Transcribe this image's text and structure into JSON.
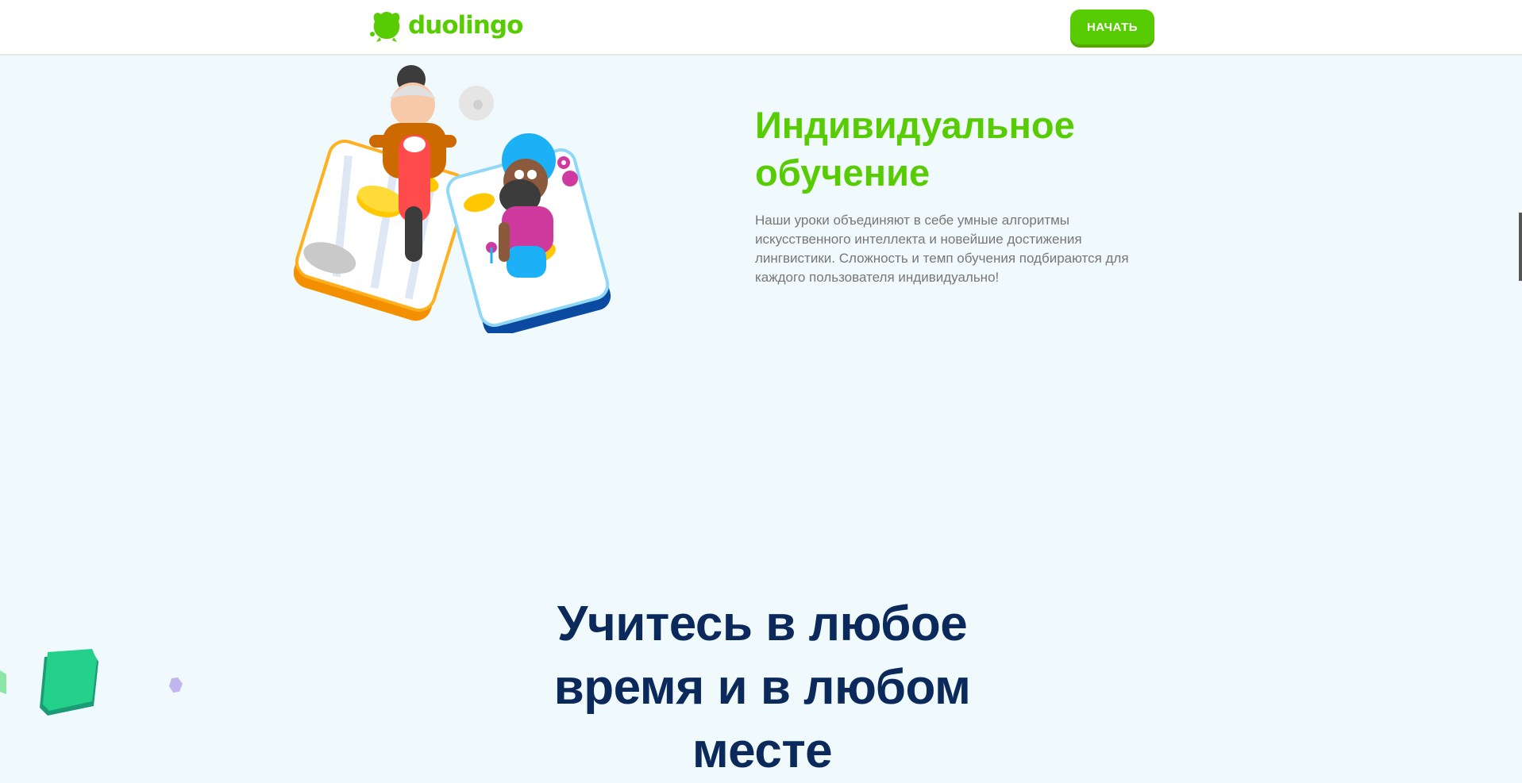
{
  "header": {
    "logo_text": "duolingo",
    "cta_label": "НАЧАТЬ"
  },
  "feature": {
    "title_line1": "Индивидуальное",
    "title_line2": "обучение",
    "description": "Наши уроки объединяют в себе умные алгоритмы искусственного интеллекта и новейшие достижения лингвистики. Сложность и темп обучения подбираются для каждого пользователя индивидуально!"
  },
  "section": {
    "title_line1": "Учитесь в любое",
    "title_line2": "время и в любом",
    "title_line3": "месте"
  },
  "colors": {
    "brand_green": "#58cc02",
    "navy": "#0b2a5b",
    "body_text": "#777777",
    "page_bg": "#f0f9fc"
  },
  "icons": {
    "logo": "duo-owl-icon",
    "illustration": "learners-on-phones-illustration"
  }
}
